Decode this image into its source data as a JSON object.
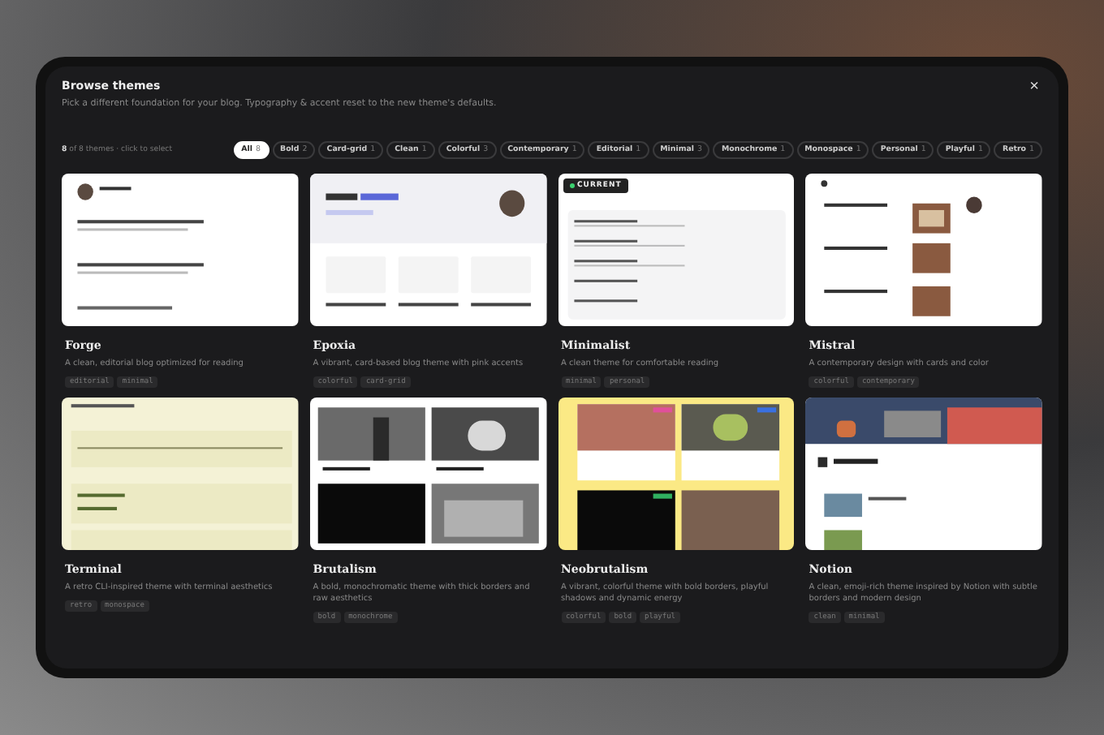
{
  "dialog": {
    "title": "Browse themes",
    "subtitle": "Pick a different foundation for your blog. Typography & accent reset to the new theme's defaults.",
    "close": "×"
  },
  "count": "**8** of 8 themes · click to select",
  "filters": [
    {
      "label": "All",
      "count": "8",
      "selected": true
    },
    {
      "label": "Bold",
      "count": "2",
      "selected": false
    },
    {
      "label": "Card-grid",
      "count": "1",
      "selected": false
    },
    {
      "label": "Clean",
      "count": "1",
      "selected": false
    },
    {
      "label": "Colorful",
      "count": "3",
      "selected": false
    },
    {
      "label": "Contemporary",
      "count": "1",
      "selected": false
    },
    {
      "label": "Editorial",
      "count": "1",
      "selected": false
    },
    {
      "label": "Minimal",
      "count": "3",
      "selected": false
    },
    {
      "label": "Monochrome",
      "count": "1",
      "selected": false
    },
    {
      "label": "Monospace",
      "count": "1",
      "selected": false
    },
    {
      "label": "Personal",
      "count": "1",
      "selected": false
    },
    {
      "label": "Playful",
      "count": "1",
      "selected": false
    },
    {
      "label": "Retro",
      "count": "1",
      "selected": false
    }
  ],
  "themes": [
    {
      "name": "Forge",
      "description": "A clean, editorial blog optimized for reading",
      "tags": [
        "editorial",
        "minimal"
      ],
      "preview": {
        "kind": "picture"
      }
    },
    {
      "name": "Epoxia",
      "description": "A vibrant, card-based blog theme with pink accents",
      "tags": [
        "colorful",
        "card-grid"
      ],
      "preview": {
        "kind": "picture"
      }
    },
    {
      "name": "Minimalist",
      "description": "A clean theme for comfortable reading",
      "tags": [
        "minimal",
        "personal"
      ],
      "preview": {
        "kind": "picture"
      },
      "badge": "CURRENT"
    },
    {
      "name": "Mistral",
      "description": "A contemporary design with cards and color",
      "tags": [
        "colorful",
        "contemporary"
      ],
      "preview": {
        "kind": "picture"
      }
    },
    {
      "name": "Terminal",
      "description": "A retro CLI-inspired theme with terminal aesthetics",
      "tags": [
        "retro",
        "monospace"
      ],
      "preview": {
        "kind": "picture"
      }
    },
    {
      "name": "Brutalism",
      "description": "A bold, monochromatic theme with thick borders and raw aesthetics",
      "tags": [
        "bold",
        "monochrome"
      ],
      "preview": {
        "kind": "picture"
      }
    },
    {
      "name": "Neobrutalism",
      "description": "A vibrant, colorful theme with bold borders, playful shadows and dynamic energy",
      "tags": [
        "colorful",
        "bold",
        "playful"
      ],
      "preview": {
        "kind": "picture"
      }
    },
    {
      "name": "Notion",
      "description": "A clean, emoji-rich theme inspired by Notion with subtle borders and modern design",
      "tags": [
        "clean",
        "minimal"
      ],
      "preview": {
        "kind": "picture"
      }
    }
  ]
}
